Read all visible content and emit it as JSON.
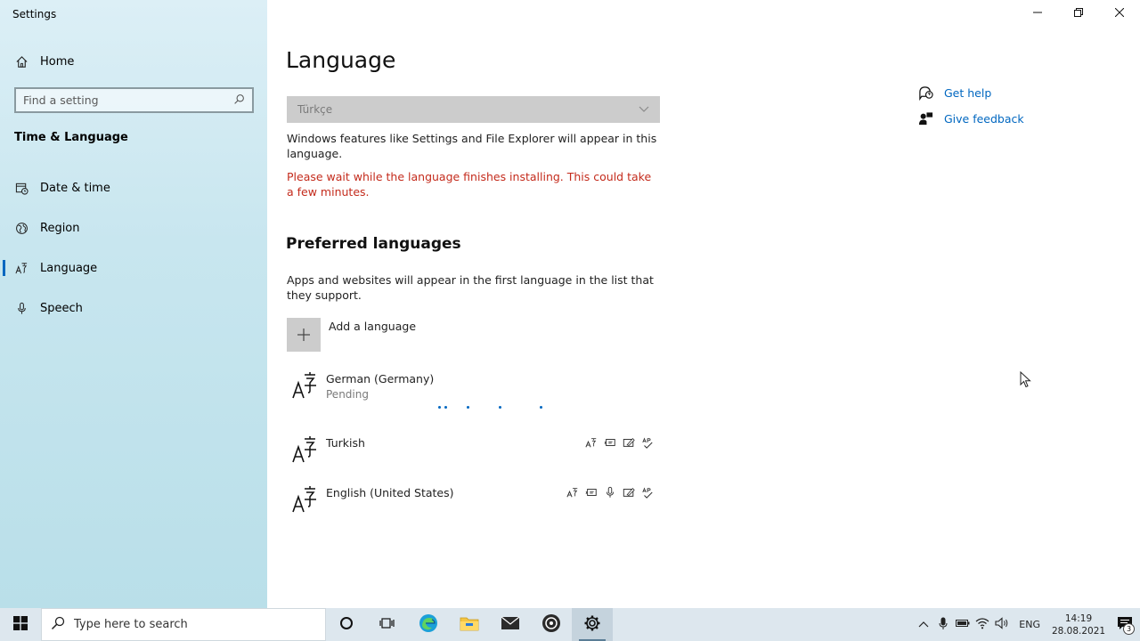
{
  "window": {
    "app_title": "Settings",
    "controls": [
      "minimize-icon",
      "restore-icon",
      "close-icon"
    ]
  },
  "sidebar": {
    "home_label": "Home",
    "search_placeholder": "Find a setting",
    "section_title": "Time & Language",
    "items": [
      {
        "label": "Date & time",
        "icon": "calendar-clock-icon",
        "active": false
      },
      {
        "label": "Region",
        "icon": "globe-icon",
        "active": false
      },
      {
        "label": "Language",
        "icon": "language-icon",
        "active": true
      },
      {
        "label": "Speech",
        "icon": "microphone-icon",
        "active": false
      }
    ]
  },
  "main": {
    "title": "Language",
    "display_language_select": "Türkçe",
    "display_description": "Windows features like Settings and File Explorer will appear in this language.",
    "install_warning": "Please wait while the language finishes installing. This could take a few minutes.",
    "preferred_title": "Preferred languages",
    "preferred_description": "Apps and websites will appear in the first language in the list that they support.",
    "add_language_label": "Add a language",
    "languages": [
      {
        "name": "German (Germany)",
        "status": "Pending",
        "features": []
      },
      {
        "name": "Turkish",
        "status": "",
        "features": [
          "display-language-icon",
          "text-to-speech-icon",
          "handwriting-icon",
          "spell-check-icon"
        ]
      },
      {
        "name": "English (United States)",
        "status": "",
        "features": [
          "display-language-icon",
          "text-to-speech-icon",
          "speech-recognition-icon",
          "handwriting-icon",
          "spell-check-icon"
        ]
      }
    ]
  },
  "help": {
    "get_help": "Get help",
    "give_feedback": "Give feedback"
  },
  "taskbar": {
    "search_placeholder": "Type here to search",
    "apps": [
      "cortana-icon",
      "task-view-icon",
      "edge-icon",
      "file-explorer-icon",
      "mail-icon",
      "media-player-icon",
      "settings-icon"
    ],
    "input_language": "ENG",
    "time": "14:19",
    "date": "28.08.2021",
    "notification_count": "3"
  },
  "colors": {
    "accent": "#0067c0",
    "warning": "#c42b1c",
    "sidebar_bg": "#c8e6ef"
  }
}
